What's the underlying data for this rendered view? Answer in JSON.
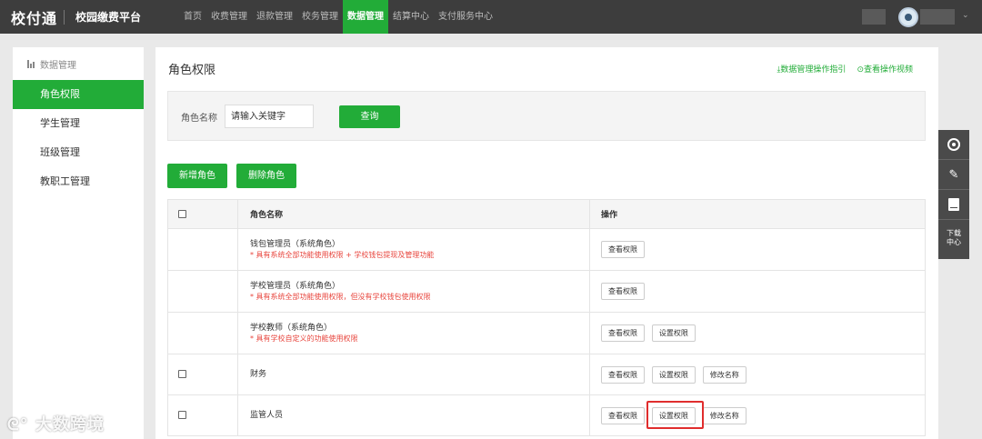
{
  "app": {
    "logo": "校付通",
    "platform": "校园缴费平台"
  },
  "nav": [
    {
      "label": "首页"
    },
    {
      "label": "收费管理"
    },
    {
      "label": "退款管理"
    },
    {
      "label": "校务管理"
    },
    {
      "label": "数据管理"
    },
    {
      "label": "结算中心"
    },
    {
      "label": "支付服务中心"
    }
  ],
  "active_nav": "数据管理",
  "sidebar": {
    "header": "数据管理",
    "items": [
      {
        "label": "角色权限"
      },
      {
        "label": "学生管理"
      },
      {
        "label": "班级管理"
      },
      {
        "label": "教职工管理"
      }
    ],
    "active": "角色权限"
  },
  "page": {
    "title": "角色权限",
    "guide_link": "数据管理操作指引",
    "video_link": "查看操作视频"
  },
  "search": {
    "label": "角色名称",
    "placeholder": "请输入关键字",
    "query_button": "查询"
  },
  "actions": {
    "add": "新增角色",
    "delete": "删除角色"
  },
  "table": {
    "headers": {
      "name": "角色名称",
      "ops": "操作"
    },
    "rows": [
      {
        "name": "钱包管理员（系统角色）",
        "desc": "* 具有系统全部功能使用权限 + 学校钱包提现及管理功能",
        "ops": [
          "查看权限"
        ],
        "checkbox": false
      },
      {
        "name": "学校管理员（系统角色）",
        "desc": "* 具有系统全部功能使用权限，但没有学校钱包使用权限",
        "ops": [
          "查看权限"
        ],
        "checkbox": false
      },
      {
        "name": "学校教师（系统角色）",
        "desc": "* 具有学校自定义的功能使用权限",
        "ops": [
          "查看权限",
          "设置权限"
        ],
        "checkbox": false
      },
      {
        "name": "财务",
        "desc": "",
        "ops": [
          "查看权限",
          "设置权限",
          "修改名称"
        ],
        "checkbox": true
      },
      {
        "name": "监管人员",
        "desc": "",
        "ops": [
          "查看权限",
          "设置权限",
          "修改名称"
        ],
        "checkbox": true
      }
    ]
  },
  "float_bar": {
    "download_line1": "下载",
    "download_line2": "中心"
  },
  "watermark": "大数跨境",
  "colors": {
    "accent": "#22ac38",
    "topbar": "#3d3d3d",
    "warning_text": "#e8463e",
    "highlight": "#e02d2d"
  }
}
